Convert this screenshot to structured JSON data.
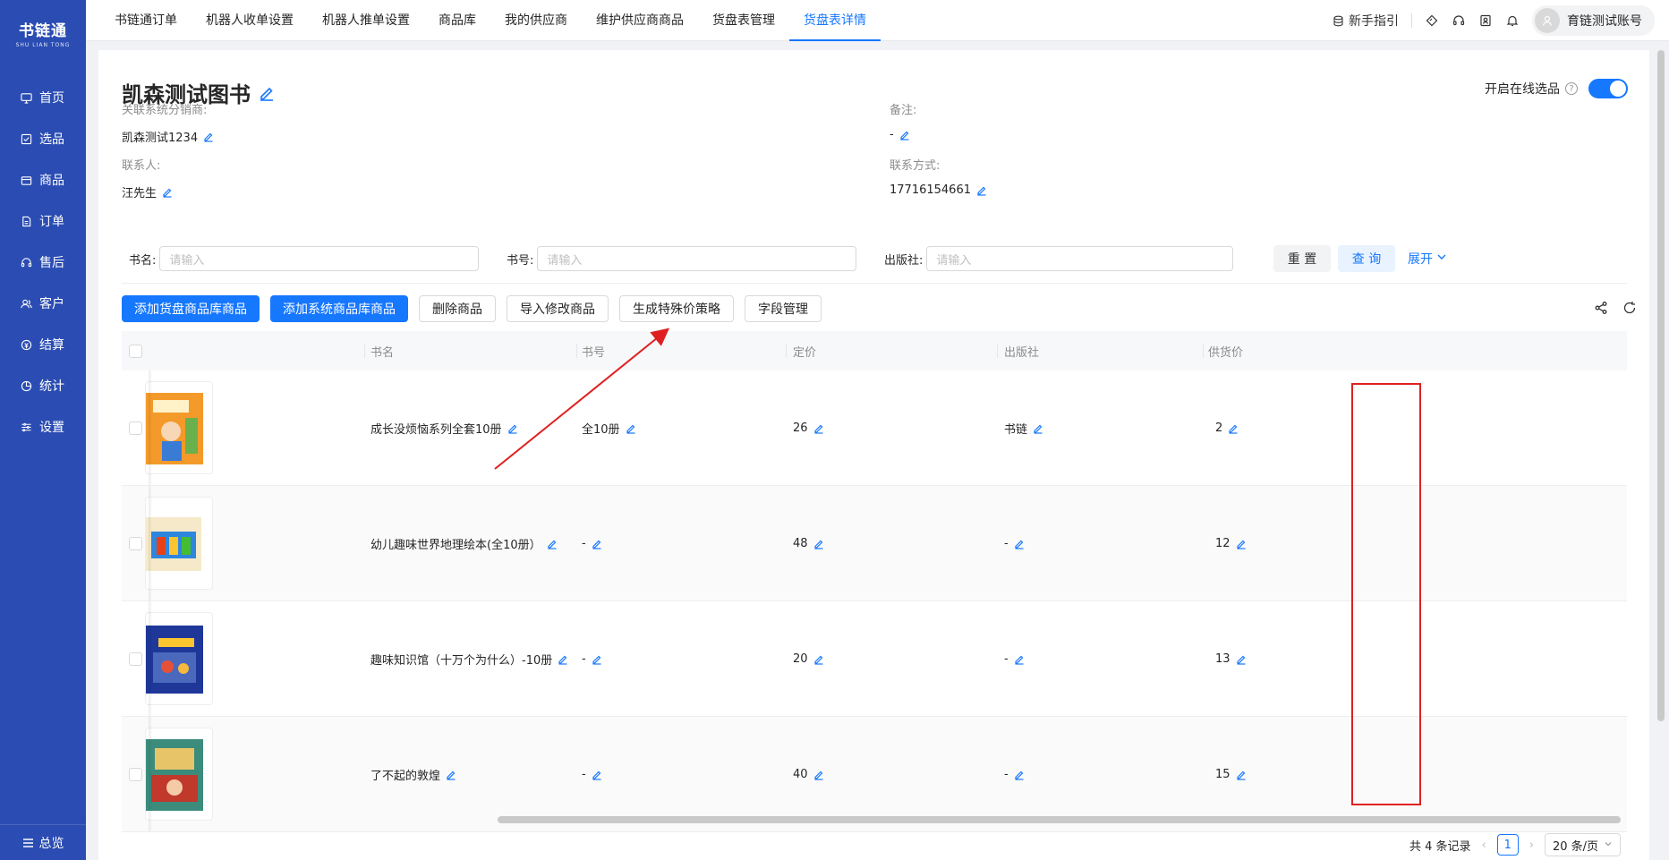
{
  "sidebar": {
    "logo_name": "书链通",
    "logo_sub": "SHU LIAN TONG",
    "items": [
      {
        "label": "首页"
      },
      {
        "label": "选品"
      },
      {
        "label": "商品"
      },
      {
        "label": "订单"
      },
      {
        "label": "售后"
      },
      {
        "label": "客户"
      },
      {
        "label": "结算"
      },
      {
        "label": "统计"
      },
      {
        "label": "设置"
      }
    ],
    "bottom_label": "总览"
  },
  "topbar": {
    "tabs": [
      {
        "label": "书链通订单"
      },
      {
        "label": "机器人收单设置"
      },
      {
        "label": "机器人推单设置"
      },
      {
        "label": "商品库"
      },
      {
        "label": "我的供应商"
      },
      {
        "label": "维护供应商商品"
      },
      {
        "label": "货盘表管理"
      },
      {
        "label": "货盘表详情"
      }
    ],
    "active_tab": "货盘表详情",
    "guide_label": "新手指引",
    "account_name": "育链测试账号"
  },
  "page": {
    "title": "凯森测试图书",
    "switch_label": "开启在线选品",
    "switch_on": true,
    "distributor_label": "关联系统分销商:",
    "distributor_value": "凯森测试1234",
    "remark_label": "备注:",
    "remark_value": "-",
    "contact_label": "联系人:",
    "contact_value": "汪先生",
    "phone_label": "联系方式:",
    "phone_value": "17716154661"
  },
  "filter": {
    "name_label": "书名:",
    "name_placeholder": "请输入",
    "isbn_label": "书号:",
    "isbn_placeholder": "请输入",
    "publisher_label": "出版社:",
    "publisher_placeholder": "请输入",
    "reset_label": "重 置",
    "query_label": "查 询",
    "expand_label": "展开"
  },
  "toolbar": {
    "add_pallet_label": "添加货盘商品库商品",
    "add_system_label": "添加系统商品库商品",
    "delete_label": "删除商品",
    "import_label": "导入修改商品",
    "special_price_label": "生成特殊价策略",
    "fields_label": "字段管理"
  },
  "table": {
    "columns": [
      "书名",
      "书号",
      "定价",
      "出版社",
      "供货价"
    ],
    "rows": [
      {
        "name": "成长没烦恼系列全套10册",
        "isbn": "全10册",
        "price": "26",
        "publisher": "书链",
        "supply_price": "2"
      },
      {
        "name": "幼儿趣味世界地理绘本(全10册）",
        "isbn": "-",
        "price": "48",
        "publisher": "-",
        "supply_price": "12"
      },
      {
        "name": "趣味知识馆（十万个为什么）-10册",
        "isbn": "-",
        "price": "20",
        "publisher": "-",
        "supply_price": "13"
      },
      {
        "name": "了不起的敦煌",
        "isbn": "-",
        "price": "40",
        "publisher": "-",
        "supply_price": "15"
      }
    ]
  },
  "pagination": {
    "total_text": "共 4 条记录",
    "current_page": "1",
    "page_size": "20 条/页"
  },
  "colors": {
    "sidebar": "#2b4db3",
    "primary": "#1677ff",
    "annotation": "#e02020"
  }
}
